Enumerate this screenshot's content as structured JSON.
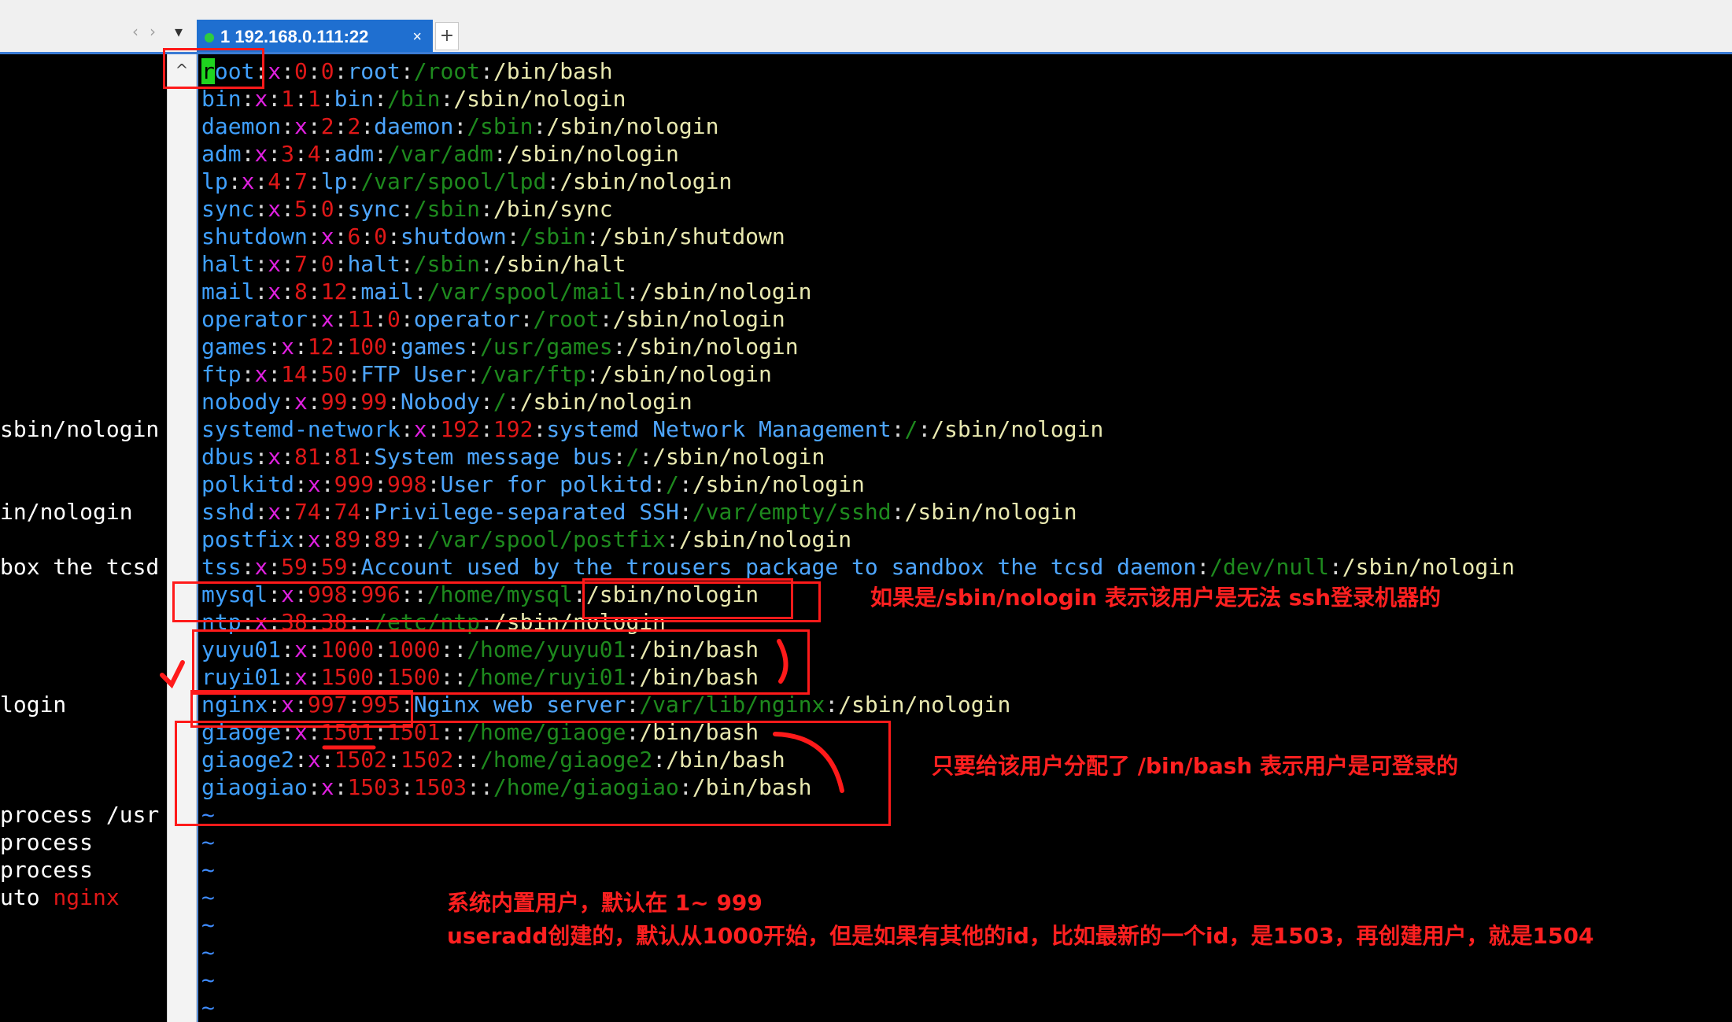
{
  "window": {
    "tab_label": "1 192.168.0.111:22",
    "tab_close": "×",
    "tab_add": "+",
    "nav_left": "‹",
    "nav_right": "›",
    "nav_menu": "▾",
    "scroll_up": "^"
  },
  "left_pane": [
    "sbin/nologin",
    "in/nologin",
    "box the tcsd",
    "login",
    "process /usr",
    "process",
    "process",
    "uto nginx"
  ],
  "passwd": [
    {
      "name": "root",
      "uid": "0",
      "gid": "0",
      "gecos": "root",
      "home": "/root",
      "shell": "/bin/bash"
    },
    {
      "name": "bin",
      "uid": "1",
      "gid": "1",
      "gecos": "bin",
      "home": "/bin",
      "shell": "/sbin/nologin"
    },
    {
      "name": "daemon",
      "uid": "2",
      "gid": "2",
      "gecos": "daemon",
      "home": "/sbin",
      "shell": "/sbin/nologin"
    },
    {
      "name": "adm",
      "uid": "3",
      "gid": "4",
      "gecos": "adm",
      "home": "/var/adm",
      "shell": "/sbin/nologin"
    },
    {
      "name": "lp",
      "uid": "4",
      "gid": "7",
      "gecos": "lp",
      "home": "/var/spool/lpd",
      "shell": "/sbin/nologin"
    },
    {
      "name": "sync",
      "uid": "5",
      "gid": "0",
      "gecos": "sync",
      "home": "/sbin",
      "shell": "/bin/sync"
    },
    {
      "name": "shutdown",
      "uid": "6",
      "gid": "0",
      "gecos": "shutdown",
      "home": "/sbin",
      "shell": "/sbin/shutdown"
    },
    {
      "name": "halt",
      "uid": "7",
      "gid": "0",
      "gecos": "halt",
      "home": "/sbin",
      "shell": "/sbin/halt"
    },
    {
      "name": "mail",
      "uid": "8",
      "gid": "12",
      "gecos": "mail",
      "home": "/var/spool/mail",
      "shell": "/sbin/nologin"
    },
    {
      "name": "operator",
      "uid": "11",
      "gid": "0",
      "gecos": "operator",
      "home": "/root",
      "shell": "/sbin/nologin"
    },
    {
      "name": "games",
      "uid": "12",
      "gid": "100",
      "gecos": "games",
      "home": "/usr/games",
      "shell": "/sbin/nologin"
    },
    {
      "name": "ftp",
      "uid": "14",
      "gid": "50",
      "gecos": "FTP User",
      "home": "/var/ftp",
      "shell": "/sbin/nologin"
    },
    {
      "name": "nobody",
      "uid": "99",
      "gid": "99",
      "gecos": "Nobody",
      "home": "/",
      "shell": "/sbin/nologin"
    },
    {
      "name": "systemd-network",
      "uid": "192",
      "gid": "192",
      "gecos": "systemd Network Management",
      "home": "/",
      "shell": "/sbin/nologin"
    },
    {
      "name": "dbus",
      "uid": "81",
      "gid": "81",
      "gecos": "System message bus",
      "home": "/",
      "shell": "/sbin/nologin"
    },
    {
      "name": "polkitd",
      "uid": "999",
      "gid": "998",
      "gecos": "User for polkitd",
      "home": "/",
      "shell": "/sbin/nologin"
    },
    {
      "name": "sshd",
      "uid": "74",
      "gid": "74",
      "gecos": "Privilege-separated SSH",
      "home": "/var/empty/sshd",
      "shell": "/sbin/nologin"
    },
    {
      "name": "postfix",
      "uid": "89",
      "gid": "89",
      "gecos": "",
      "home": "/var/spool/postfix",
      "shell": "/sbin/nologin"
    },
    {
      "name": "tss",
      "uid": "59",
      "gid": "59",
      "gecos": "Account used by the trousers package to sandbox the tcsd daemon",
      "home": "/dev/null",
      "shell": "/sbin/nologin"
    },
    {
      "name": "mysql",
      "uid": "998",
      "gid": "996",
      "gecos": "",
      "home": "/home/mysql",
      "shell": "/sbin/nologin"
    },
    {
      "name": "ntp",
      "uid": "38",
      "gid": "38",
      "gecos": "",
      "home": "/etc/ntp",
      "shell": "/sbin/nologin"
    },
    {
      "name": "yuyu01",
      "uid": "1000",
      "gid": "1000",
      "gecos": "",
      "home": "/home/yuyu01",
      "shell": "/bin/bash"
    },
    {
      "name": "ruyi01",
      "uid": "1500",
      "gid": "1500",
      "gecos": "",
      "home": "/home/ruyi01",
      "shell": "/bin/bash"
    },
    {
      "name": "nginx",
      "uid": "997",
      "gid": "995",
      "gecos": "Nginx web server",
      "home": "/var/lib/nginx",
      "shell": "/sbin/nologin"
    },
    {
      "name": "giaoge",
      "uid": "1501",
      "gid": "1501",
      "gecos": "",
      "home": "/home/giaoge",
      "shell": "/bin/bash"
    },
    {
      "name": "giaoge2",
      "uid": "1502",
      "gid": "1502",
      "gecos": "",
      "home": "/home/giaoge2",
      "shell": "/bin/bash"
    },
    {
      "name": "giaogiao",
      "uid": "1503",
      "gid": "1503",
      "gecos": "",
      "home": "/home/giaogiao",
      "shell": "/bin/bash"
    }
  ],
  "tilde_lines": [
    "~",
    "~",
    "~",
    "~",
    "~",
    "~",
    "~",
    "~"
  ],
  "annotations": {
    "nologin_note": "如果是/sbin/nologin 表示该用户是无法 ssh登录机器的",
    "bash_note": "只要给该用户分配了 /bin/bash 表示用户是可登录的",
    "builtin_note": "系统内置用户，默认在 1~ 999",
    "useradd_note": "useradd创建的，默认从1000开始，但是如果有其他的id，比如最新的一个id，是1503，再创建用户，就是1504"
  },
  "colors": {
    "name": "#3fa0ff",
    "password_x": "#e020e0",
    "ids": "#e01818",
    "home": "#1e8a1e",
    "shell": "#e9e9b0",
    "annotation": "#ff2020"
  }
}
